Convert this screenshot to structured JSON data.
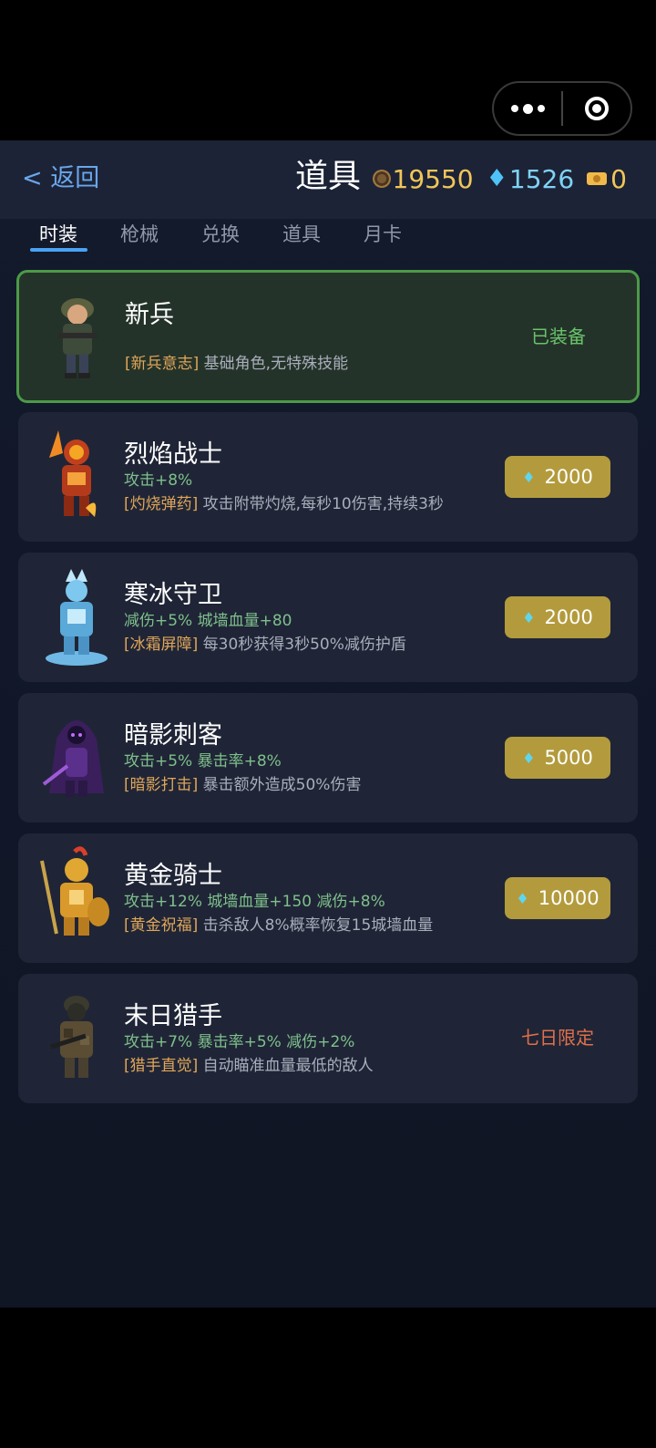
{
  "header": {
    "back_label": "< 返回",
    "title": "道具",
    "coins": "19550",
    "gems": "1526",
    "tickets": "0"
  },
  "tabs": [
    {
      "label": "时装",
      "active": true
    },
    {
      "label": "枪械",
      "active": false
    },
    {
      "label": "兑换",
      "active": false
    },
    {
      "label": "道具",
      "active": false
    },
    {
      "label": "月卡",
      "active": false
    }
  ],
  "items": [
    {
      "name": "新兵",
      "stats": "",
      "skill_tag": "[新兵意志]",
      "skill_desc": "基础角色,无特殊技能",
      "status": "已装备",
      "status_color": "#69c36b",
      "icon": "soldier-recruit-avatar"
    },
    {
      "name": "烈焰战士",
      "stats": "攻击+8%",
      "skill_tag": "[灼烧弹药]",
      "skill_desc": "攻击附带灼烧,每秒10伤害,持续3秒",
      "price": "2000",
      "icon": "flame-warrior-avatar"
    },
    {
      "name": "寒冰守卫",
      "stats": "减伤+5% 城墙血量+80",
      "skill_tag": "[冰霜屏障]",
      "skill_desc": "每30秒获得3秒50%减伤护盾",
      "price": "2000",
      "icon": "ice-guard-avatar"
    },
    {
      "name": "暗影刺客",
      "stats": "攻击+5% 暴击率+8%",
      "skill_tag": "[暗影打击]",
      "skill_desc": "暴击额外造成50%伤害",
      "price": "5000",
      "icon": "shadow-assassin-avatar"
    },
    {
      "name": "黄金骑士",
      "stats": "攻击+12% 城墙血量+150 减伤+8%",
      "skill_tag": "[黄金祝福]",
      "skill_desc": "击杀敌人8%概率恢复15城墙血量",
      "price": "10000",
      "icon": "golden-knight-avatar"
    },
    {
      "name": "末日猎手",
      "stats": "攻击+7% 暴击率+5% 减伤+2%",
      "skill_tag": "[猎手直觉]",
      "skill_desc": "自动瞄准血量最低的敌人",
      "status": "七日限定",
      "status_color": "#e0704c",
      "icon": "doom-hunter-avatar"
    }
  ],
  "colors": {
    "accent": "#4aa2f2",
    "price_button": "#b39b3d",
    "coin_text": "#f2c55a",
    "gem_text": "#7fd3f5"
  }
}
